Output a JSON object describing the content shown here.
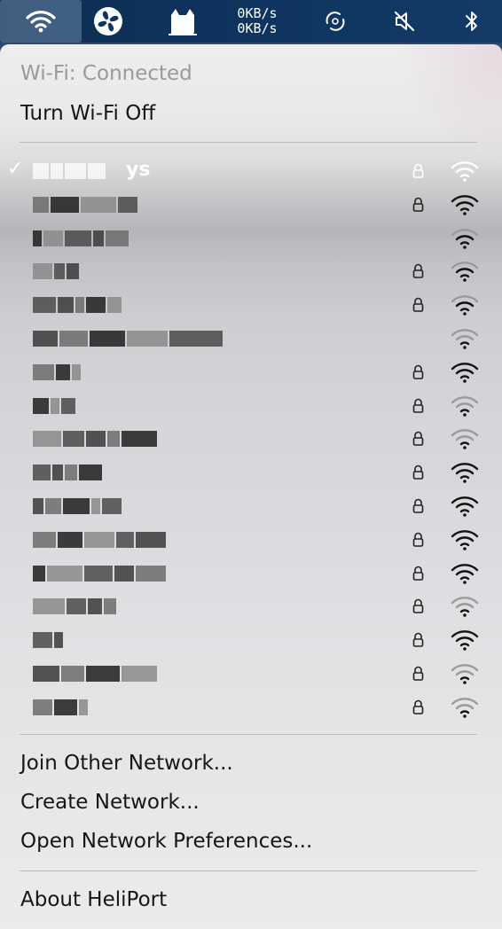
{
  "menubar": {
    "icons": [
      "wifi-icon",
      "fan-icon",
      "cat-icon",
      "circular-arrows-icon",
      "speaker-muted-icon",
      "bluetooth-icon"
    ],
    "net_up": "0KB/s",
    "net_down": "0KB/s"
  },
  "menu": {
    "status": "Wi-Fi: Connected",
    "toggle_label": "Turn Wi-Fi Off",
    "join_other": "Join Other Network...",
    "create_network": "Create Network...",
    "open_prefs": "Open Network Preferences...",
    "about": "About HeliPort"
  },
  "networks": [
    {
      "ssid_visible": "ys",
      "connected": true,
      "locked": true,
      "signal": "strong"
    },
    {
      "connected": false,
      "locked": true,
      "signal": "strong"
    },
    {
      "connected": false,
      "locked": false,
      "signal": "medium"
    },
    {
      "connected": false,
      "locked": true,
      "signal": "medium"
    },
    {
      "connected": false,
      "locked": true,
      "signal": "medium"
    },
    {
      "connected": false,
      "locked": false,
      "signal": "weak"
    },
    {
      "connected": false,
      "locked": true,
      "signal": "strong"
    },
    {
      "connected": false,
      "locked": true,
      "signal": "weak"
    },
    {
      "connected": false,
      "locked": true,
      "signal": "weak"
    },
    {
      "connected": false,
      "locked": true,
      "signal": "strong"
    },
    {
      "connected": false,
      "locked": true,
      "signal": "strong"
    },
    {
      "connected": false,
      "locked": true,
      "signal": "strong"
    },
    {
      "connected": false,
      "locked": true,
      "signal": "strong"
    },
    {
      "connected": false,
      "locked": true,
      "signal": "weak"
    },
    {
      "connected": false,
      "locked": true,
      "signal": "strong"
    },
    {
      "connected": false,
      "locked": true,
      "signal": "weak"
    },
    {
      "connected": false,
      "locked": true,
      "signal": "weak"
    }
  ]
}
